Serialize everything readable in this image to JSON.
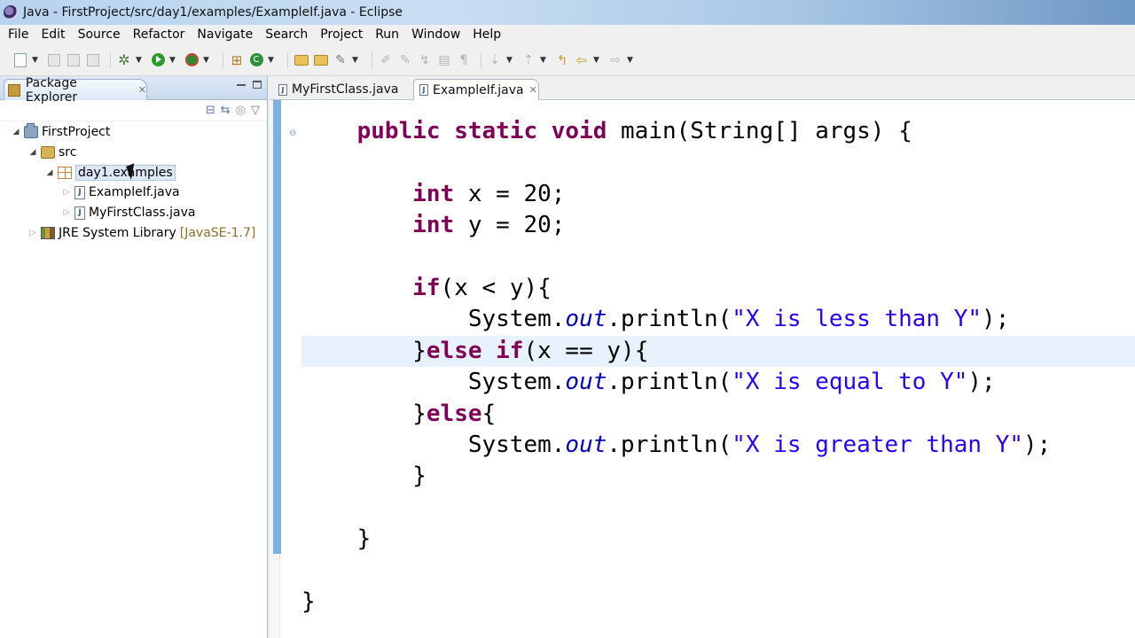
{
  "window": {
    "title": "Java - FirstProject/src/day1/examples/ExampleIf.java - Eclipse"
  },
  "menu": [
    "File",
    "Edit",
    "Source",
    "Refactor",
    "Navigate",
    "Search",
    "Project",
    "Run",
    "Window",
    "Help"
  ],
  "package_explorer": {
    "tab_label": "Package Explorer",
    "tree": {
      "project": "FirstProject",
      "src": "src",
      "package": "day1.examples",
      "file1": "ExampleIf.java",
      "file2": "MyFirstClass.java",
      "library": "JRE System Library",
      "library_decor": "[JavaSE-1.7]"
    }
  },
  "editor": {
    "tabs": [
      {
        "label": "MyFirstClass.java",
        "active": false
      },
      {
        "label": "ExampleIf.java",
        "active": true
      }
    ],
    "code": {
      "l1_kw": "public static void",
      "l1_rest": " main(String[] args) {",
      "l3_kw": "int",
      "l3_rest": " x = 20;",
      "l4_kw": "int",
      "l4_rest": " y = 20;",
      "l6_kw": "if",
      "l6_rest": "(x < y){",
      "l7_a": "System.",
      "l7_field": "out",
      "l7_b": ".println(",
      "l7_str": "\"X is less than Y\"",
      "l7_end": ");",
      "l8_a": "}",
      "l8_kw": "else if",
      "l8_rest": "(x == y){",
      "l9_a": "System.",
      "l9_field": "out",
      "l9_b": ".println(",
      "l9_str": "\"X is equal to Y\"",
      "l9_end": ");",
      "l10_a": "}",
      "l10_kw": "else",
      "l10_rest": "{",
      "l11_a": "System.",
      "l11_field": "out",
      "l11_b": ".println(",
      "l11_str": "\"X is greater than Y\"",
      "l11_end": ");",
      "l12": "}",
      "l14": "}",
      "l16": "}"
    }
  },
  "colors": {
    "keyword": "#7f0055",
    "string": "#2a00ff",
    "field": "#0000c0",
    "current_line": "#e8f2fe"
  }
}
